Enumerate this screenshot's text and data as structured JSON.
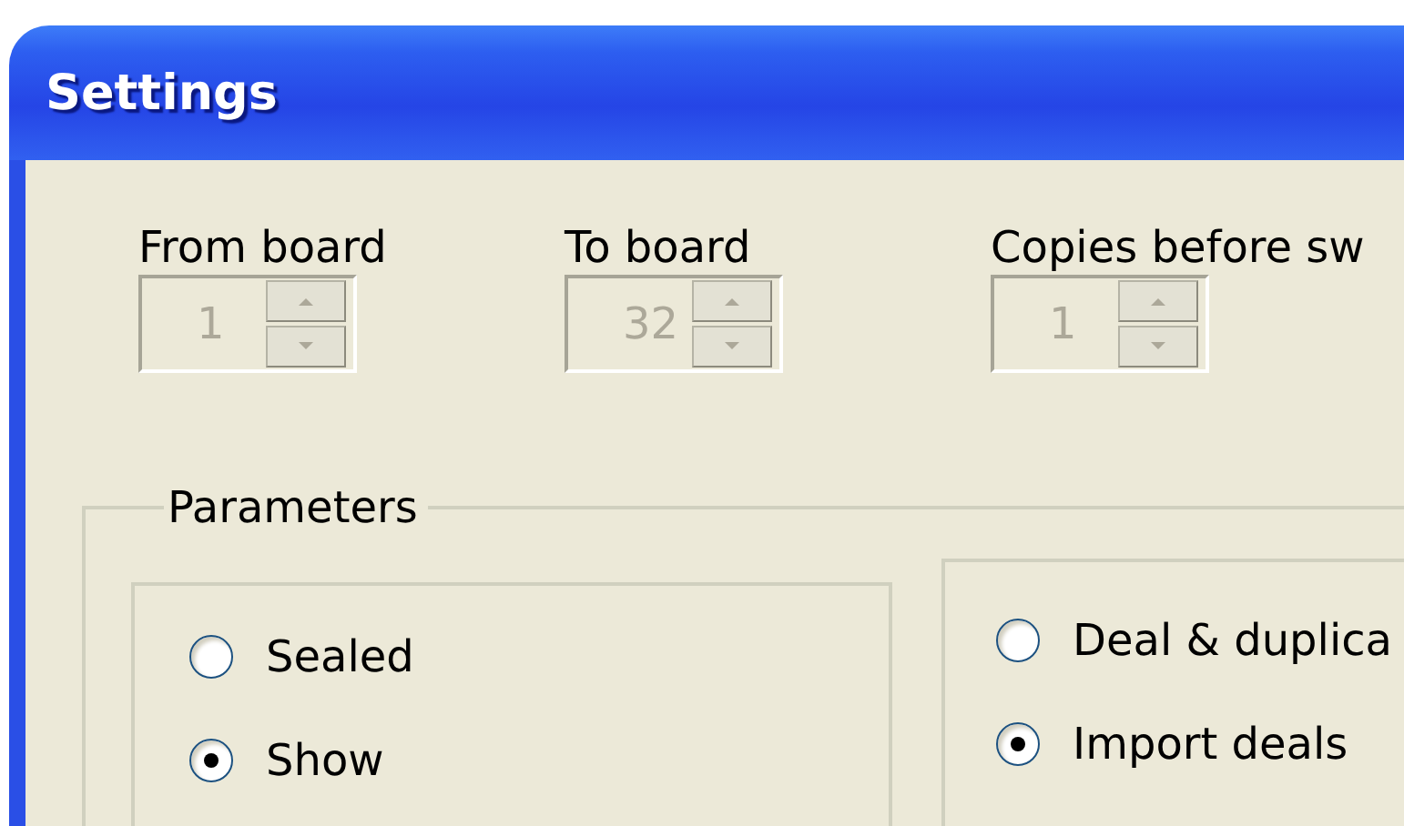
{
  "window": {
    "title": "Settings"
  },
  "spinners": [
    {
      "label": "From board",
      "value": "1",
      "disabled": true
    },
    {
      "label": "To board",
      "value": "32",
      "disabled": true
    },
    {
      "label": "Copies before sw",
      "value": "1",
      "disabled": true
    }
  ],
  "parameters": {
    "title": "Parameters",
    "groups": [
      {
        "options": [
          {
            "label": "Sealed",
            "selected": false
          },
          {
            "label": "Show",
            "selected": true
          }
        ]
      },
      {
        "options": [
          {
            "label": "Deal & duplica",
            "selected": false
          },
          {
            "label": "Import deals",
            "selected": true
          }
        ]
      }
    ]
  }
}
